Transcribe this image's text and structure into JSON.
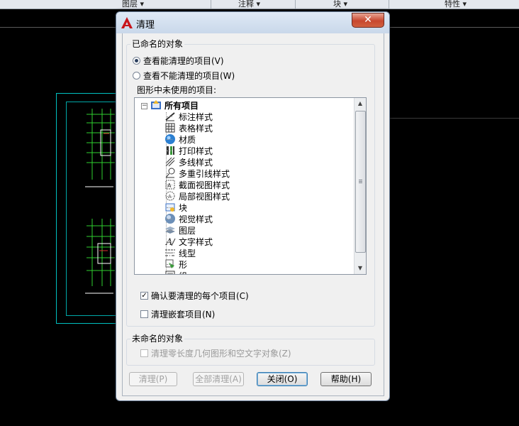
{
  "ribbon": {
    "items": [
      "图层",
      "注释",
      "块",
      "特性"
    ]
  },
  "dialog": {
    "title": "清理",
    "close_label": "✕",
    "named_group": {
      "title": "已命名的对象",
      "radio_purgeable": "查看能清理的项目(V)",
      "radio_nonpurgeable": "查看不能清理的项目(W)",
      "tree_label": "图形中未使用的项目:",
      "tree": {
        "root": "所有项目",
        "items": [
          "标注样式",
          "表格样式",
          "材质",
          "打印样式",
          "多线样式",
          "多重引线样式",
          "截面视图样式",
          "局部视图样式",
          "块",
          "视觉样式",
          "图层",
          "文字样式",
          "线型",
          "形",
          "组"
        ]
      },
      "check_confirm": "确认要清理的每个项目(C)",
      "check_nested": "清理嵌套项目(N)"
    },
    "unnamed_group": {
      "title": "未命名的对象",
      "check_zero_length": "清理零长度几何图形和空文字对象(Z)"
    },
    "buttons": {
      "purge": "清理(P)",
      "purge_all": "全部清理(A)",
      "close": "关闭(O)",
      "help": "帮助(H)"
    }
  }
}
